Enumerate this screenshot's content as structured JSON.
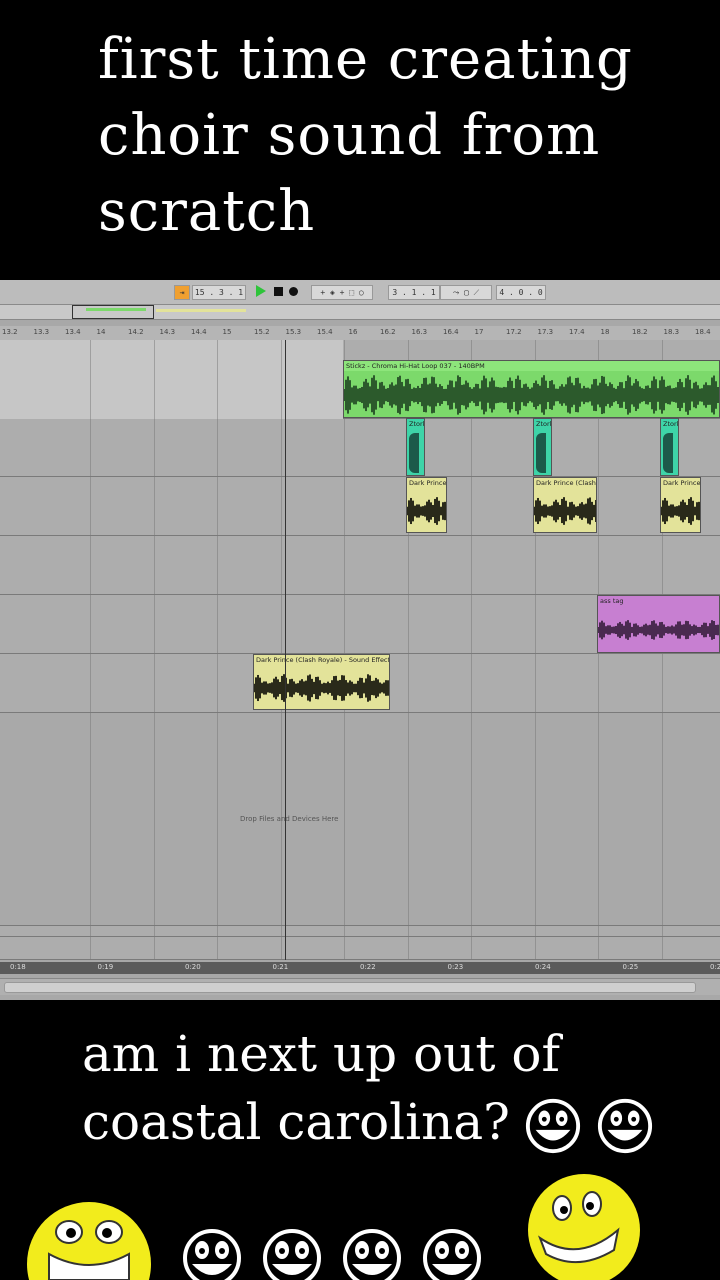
{
  "caption_top": {
    "line1": "first time creating",
    "line2": "choir sound from",
    "line3": "scratch"
  },
  "caption_bottom": {
    "line1": "am i next up out of",
    "line2": "coastal carolina?"
  },
  "daw": {
    "transport": {
      "position": "15 . 3 . 1",
      "loop_start": "3 . 1 . 1",
      "loop_length": "4 . 0 . 0"
    },
    "ruler_labels": [
      "13.2",
      "13.3",
      "13.4",
      "14",
      "14.2",
      "14.3",
      "14.4",
      "15",
      "15.2",
      "15.3",
      "15.4",
      "16",
      "16.2",
      "16.3",
      "16.4",
      "17",
      "17.2",
      "17.3",
      "17.4",
      "18",
      "18.2",
      "18.3",
      "18.4"
    ],
    "time_labels": [
      "0:18",
      "0:19",
      "0:20",
      "0:21",
      "0:22",
      "0:23",
      "0:24",
      "0:25",
      "0:2"
    ],
    "clips": {
      "hihat": "Stickz - Chroma Hi-Hat Loop 037 - 140BPM",
      "ztork_1": "Ztork",
      "ztork_2": "Ztork",
      "ztork_3": "Ztork",
      "dark_prince_1": "Dark Prince",
      "dark_prince_2": "Dark Prince (Clash",
      "dark_prince_3": "Dark Prince",
      "ass_tag": "ass tag",
      "dark_prince_full": "Dark Prince (Clash Royale) - Sound Effect"
    },
    "drop_hint": "Drop Files and Devices Here"
  },
  "colors": {
    "hihat_clip": "#7cd96b",
    "ztork_clip": "#3ed4a8",
    "dark_prince_clip": "#e3e39a",
    "ass_tag_clip": "#c77fd1",
    "emoji_yellow": "#f2ec1c"
  },
  "icons": [
    "play-icon",
    "stop-icon",
    "record-icon",
    "grinning-emoji-icon"
  ]
}
